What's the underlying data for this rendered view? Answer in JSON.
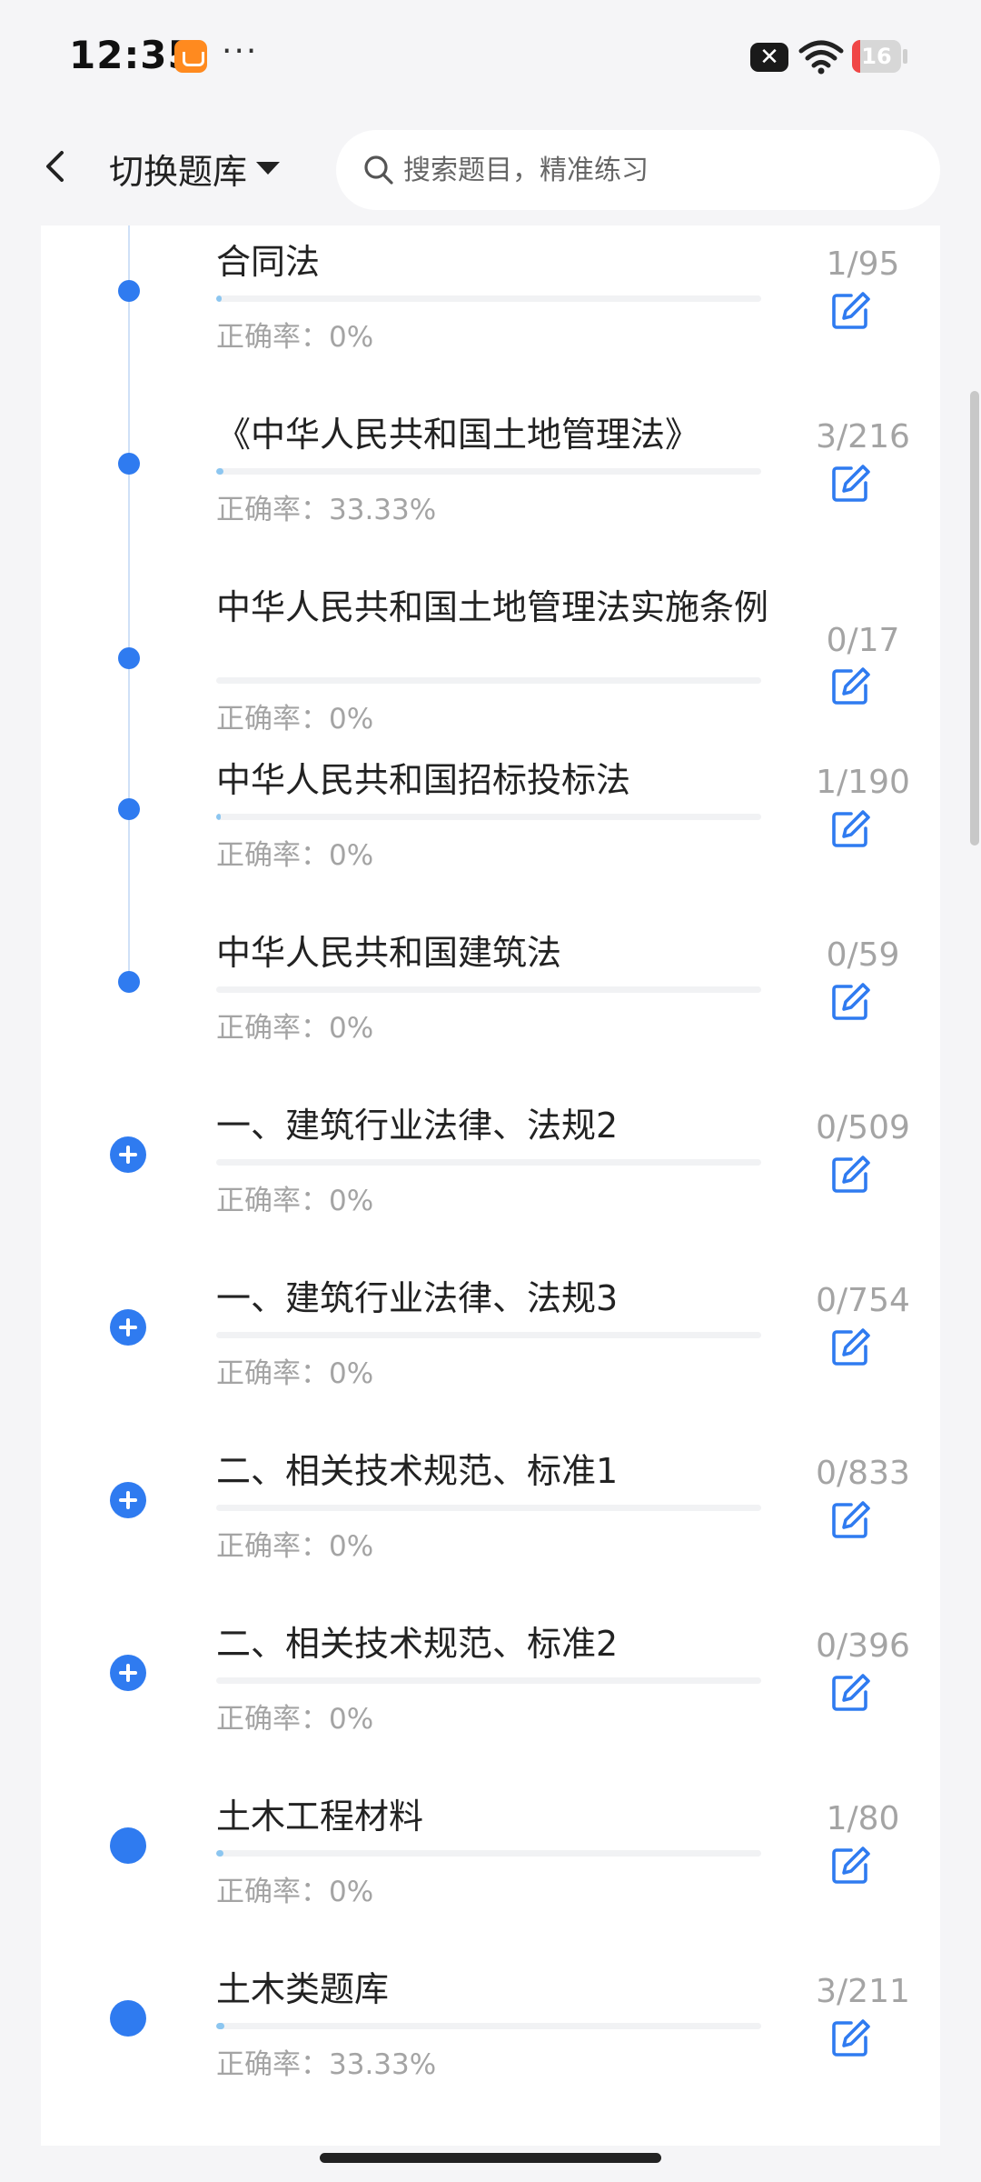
{
  "status_bar": {
    "time": "12:35",
    "more": "···",
    "notification": "✕",
    "battery": "16",
    "battery_level": 0.16
  },
  "header": {
    "switch_bank_label": "切换题库",
    "search_placeholder": "搜索题目，精准练习"
  },
  "accuracy_label": "正确率：",
  "items": [
    {
      "title": "合同法",
      "accuracy": "0%",
      "count": "1/95",
      "progress": 0.0105,
      "node": "dot"
    },
    {
      "title": "《中华人民共和国土地管理法》",
      "accuracy": "33.33%",
      "count": "3/216",
      "progress": 0.0139,
      "node": "dot"
    },
    {
      "title": "中华人民共和国土地管理法实施条例",
      "accuracy": "0%",
      "count": "0/17",
      "progress": 0,
      "node": "dot"
    },
    {
      "title": "中华人民共和国招标投标法",
      "accuracy": "0%",
      "count": "1/190",
      "progress": 0.0053,
      "node": "dot"
    },
    {
      "title": "中华人民共和国建筑法",
      "accuracy": "0%",
      "count": "0/59",
      "progress": 0,
      "node": "dot"
    },
    {
      "title": "一、建筑行业法律、法规2",
      "accuracy": "0%",
      "count": "0/509",
      "progress": 0,
      "node": "plus"
    },
    {
      "title": "一、建筑行业法律、法规3",
      "accuracy": "0%",
      "count": "0/754",
      "progress": 0,
      "node": "plus"
    },
    {
      "title": "二、相关技术规范、标准1",
      "accuracy": "0%",
      "count": "0/833",
      "progress": 0,
      "node": "plus"
    },
    {
      "title": "二、相关技术规范、标准2",
      "accuracy": "0%",
      "count": "0/396",
      "progress": 0,
      "node": "plus"
    },
    {
      "title": "土木工程材料",
      "accuracy": "0%",
      "count": "1/80",
      "progress": 0.0125,
      "node": "big"
    },
    {
      "title": "土木类题库",
      "accuracy": "33.33%",
      "count": "3/211",
      "progress": 0.0142,
      "node": "big"
    }
  ],
  "colors": {
    "accent": "#2f7bf0",
    "progress_fill": "#8cc6f0",
    "muted_text": "#a4a4a4",
    "battery_low": "#f04646"
  }
}
